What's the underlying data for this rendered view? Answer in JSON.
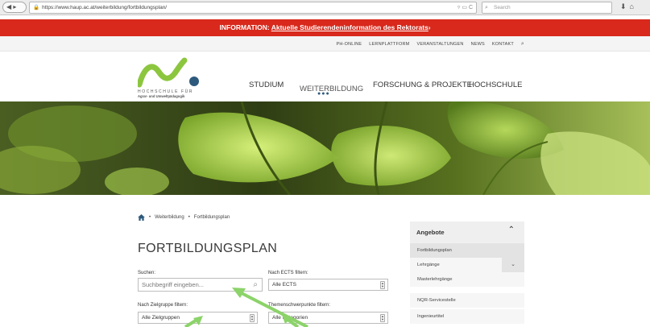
{
  "browser": {
    "url": "https://www.haup.ac.at/weiterbildung/fortbildungsplan/",
    "search_placeholder": "Search"
  },
  "banner": {
    "prefix": "INFORMATION:",
    "link": "Aktuelle Studierendeninformation des Rektorats",
    "color": "#d8291c"
  },
  "utility_nav": [
    "PH-ONLINE",
    "LERNPLATTFORM",
    "VERANSTALTUNGEN",
    "NEWS",
    "KONTAKT"
  ],
  "logo": {
    "line1": "HOCHSCHULE FÜR",
    "line2": "Agrar- und Umweltpädagogik",
    "green": "#8cc63f",
    "blue": "#2d5a7c"
  },
  "main_nav": {
    "studium": "STUDIUM",
    "weiterbildung": "WEITERBILDUNG",
    "forschung": "FORSCHUNG & PROJEKTE",
    "hochschule": "HOCHSCHULE",
    "active_marker": "●●●"
  },
  "breadcrumb": [
    "Weiterbildung",
    "Fortbildungsplan"
  ],
  "page_title": "FORTBILDUNGSPLAN",
  "filters": {
    "search_label": "Suchen:",
    "search_placeholder": "Suchbegriff eingeben...",
    "ects_label": "Nach ECTS filtern:",
    "ects_value": "Alle ECTS",
    "zielgruppe_label": "Nach Zielgruppe filtern:",
    "zielgruppe_value": "Alle Zielgruppen",
    "themen_label": "Themenschwerpunkte filtern:",
    "themen_value": "Alle Kategorien"
  },
  "sidebar": {
    "heading": "Angebote",
    "items": [
      "Fortbildungsplan",
      "Lehrgänge",
      "Masterlehrgänge"
    ],
    "items2": [
      "NQR-Servicestelle",
      "Ingenieurtitel"
    ]
  }
}
